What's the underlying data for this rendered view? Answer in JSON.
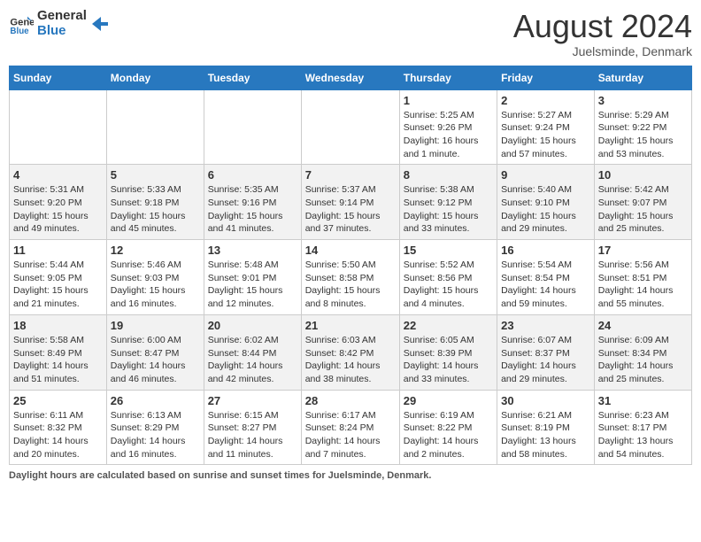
{
  "header": {
    "logo_line1": "General",
    "logo_line2": "Blue",
    "month_year": "August 2024",
    "location": "Juelsminde, Denmark"
  },
  "days_of_week": [
    "Sunday",
    "Monday",
    "Tuesday",
    "Wednesday",
    "Thursday",
    "Friday",
    "Saturday"
  ],
  "weeks": [
    [
      {
        "num": "",
        "info": ""
      },
      {
        "num": "",
        "info": ""
      },
      {
        "num": "",
        "info": ""
      },
      {
        "num": "",
        "info": ""
      },
      {
        "num": "1",
        "info": "Sunrise: 5:25 AM\nSunset: 9:26 PM\nDaylight: 16 hours and 1 minute."
      },
      {
        "num": "2",
        "info": "Sunrise: 5:27 AM\nSunset: 9:24 PM\nDaylight: 15 hours and 57 minutes."
      },
      {
        "num": "3",
        "info": "Sunrise: 5:29 AM\nSunset: 9:22 PM\nDaylight: 15 hours and 53 minutes."
      }
    ],
    [
      {
        "num": "4",
        "info": "Sunrise: 5:31 AM\nSunset: 9:20 PM\nDaylight: 15 hours and 49 minutes."
      },
      {
        "num": "5",
        "info": "Sunrise: 5:33 AM\nSunset: 9:18 PM\nDaylight: 15 hours and 45 minutes."
      },
      {
        "num": "6",
        "info": "Sunrise: 5:35 AM\nSunset: 9:16 PM\nDaylight: 15 hours and 41 minutes."
      },
      {
        "num": "7",
        "info": "Sunrise: 5:37 AM\nSunset: 9:14 PM\nDaylight: 15 hours and 37 minutes."
      },
      {
        "num": "8",
        "info": "Sunrise: 5:38 AM\nSunset: 9:12 PM\nDaylight: 15 hours and 33 minutes."
      },
      {
        "num": "9",
        "info": "Sunrise: 5:40 AM\nSunset: 9:10 PM\nDaylight: 15 hours and 29 minutes."
      },
      {
        "num": "10",
        "info": "Sunrise: 5:42 AM\nSunset: 9:07 PM\nDaylight: 15 hours and 25 minutes."
      }
    ],
    [
      {
        "num": "11",
        "info": "Sunrise: 5:44 AM\nSunset: 9:05 PM\nDaylight: 15 hours and 21 minutes."
      },
      {
        "num": "12",
        "info": "Sunrise: 5:46 AM\nSunset: 9:03 PM\nDaylight: 15 hours and 16 minutes."
      },
      {
        "num": "13",
        "info": "Sunrise: 5:48 AM\nSunset: 9:01 PM\nDaylight: 15 hours and 12 minutes."
      },
      {
        "num": "14",
        "info": "Sunrise: 5:50 AM\nSunset: 8:58 PM\nDaylight: 15 hours and 8 minutes."
      },
      {
        "num": "15",
        "info": "Sunrise: 5:52 AM\nSunset: 8:56 PM\nDaylight: 15 hours and 4 minutes."
      },
      {
        "num": "16",
        "info": "Sunrise: 5:54 AM\nSunset: 8:54 PM\nDaylight: 14 hours and 59 minutes."
      },
      {
        "num": "17",
        "info": "Sunrise: 5:56 AM\nSunset: 8:51 PM\nDaylight: 14 hours and 55 minutes."
      }
    ],
    [
      {
        "num": "18",
        "info": "Sunrise: 5:58 AM\nSunset: 8:49 PM\nDaylight: 14 hours and 51 minutes."
      },
      {
        "num": "19",
        "info": "Sunrise: 6:00 AM\nSunset: 8:47 PM\nDaylight: 14 hours and 46 minutes."
      },
      {
        "num": "20",
        "info": "Sunrise: 6:02 AM\nSunset: 8:44 PM\nDaylight: 14 hours and 42 minutes."
      },
      {
        "num": "21",
        "info": "Sunrise: 6:03 AM\nSunset: 8:42 PM\nDaylight: 14 hours and 38 minutes."
      },
      {
        "num": "22",
        "info": "Sunrise: 6:05 AM\nSunset: 8:39 PM\nDaylight: 14 hours and 33 minutes."
      },
      {
        "num": "23",
        "info": "Sunrise: 6:07 AM\nSunset: 8:37 PM\nDaylight: 14 hours and 29 minutes."
      },
      {
        "num": "24",
        "info": "Sunrise: 6:09 AM\nSunset: 8:34 PM\nDaylight: 14 hours and 25 minutes."
      }
    ],
    [
      {
        "num": "25",
        "info": "Sunrise: 6:11 AM\nSunset: 8:32 PM\nDaylight: 14 hours and 20 minutes."
      },
      {
        "num": "26",
        "info": "Sunrise: 6:13 AM\nSunset: 8:29 PM\nDaylight: 14 hours and 16 minutes."
      },
      {
        "num": "27",
        "info": "Sunrise: 6:15 AM\nSunset: 8:27 PM\nDaylight: 14 hours and 11 minutes."
      },
      {
        "num": "28",
        "info": "Sunrise: 6:17 AM\nSunset: 8:24 PM\nDaylight: 14 hours and 7 minutes."
      },
      {
        "num": "29",
        "info": "Sunrise: 6:19 AM\nSunset: 8:22 PM\nDaylight: 14 hours and 2 minutes."
      },
      {
        "num": "30",
        "info": "Sunrise: 6:21 AM\nSunset: 8:19 PM\nDaylight: 13 hours and 58 minutes."
      },
      {
        "num": "31",
        "info": "Sunrise: 6:23 AM\nSunset: 8:17 PM\nDaylight: 13 hours and 54 minutes."
      }
    ]
  ],
  "footer": {
    "label": "Daylight hours",
    "description": "are calculated based on sunrise and sunset times for Juelsminde, Denmark."
  }
}
